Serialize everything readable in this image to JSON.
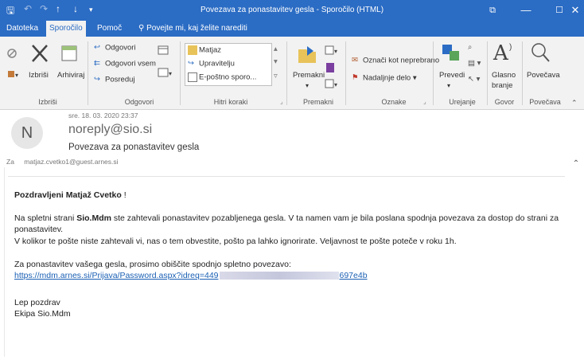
{
  "window": {
    "title": "Povezava za ponastavitev gesla  -  Sporočilo (HTML)",
    "controls": {
      "restore": "⧉",
      "minimize": "—",
      "maximize": "☐",
      "close": "✕"
    }
  },
  "quick_access": {
    "save": "🖫",
    "undo": "↶",
    "redo": "↷",
    "up": "↑",
    "down": "↓",
    "customize": "▾"
  },
  "tabs": [
    "Datoteka",
    "Sporočilo",
    "Pomoč"
  ],
  "tell_me": "Povejte mi, kaj želite narediti",
  "ribbon": {
    "groups": {
      "delete": "Izbriši",
      "respond": "Odgovori",
      "quick_steps": "Hitri koraki",
      "move": "Premakni",
      "tags": "Oznake",
      "editing": "Urejanje",
      "speech": "Govor",
      "zoom": "Povečava"
    },
    "delete_label": "Izbriši",
    "archive_label": "Arhiviraj",
    "reply": "Odgovori",
    "reply_all": "Odgovori vsem",
    "forward": "Posreduj",
    "quick_steps": [
      "Matjaz",
      "Upravitelju",
      "E-poštno sporo..."
    ],
    "move_label": "Premakni",
    "mark_unread": "Označi kot neprebrano",
    "follow_up": "Nadaljnje delo",
    "translate": "Prevedi",
    "read_aloud_1": "Glasno",
    "read_aloud_2": "branje",
    "zoom": "Povečava"
  },
  "message": {
    "avatar_letter": "N",
    "date": "sre. 18. 03. 2020 23:37",
    "sender": "noreply@sio.si",
    "subject": "Povezava za ponastavitev gesla",
    "to_label": "Za",
    "to_address": "matjaz.cvetko1@guest.arnes.si"
  },
  "body": {
    "greeting_bold": "Pozdravljeni Matjaž Cvetko",
    "greeting_end": " !",
    "p1_a": "Na spletni strani ",
    "p1_bold": "Sio.Mdm",
    "p1_b": " ste zahtevali ponastavitev pozabljenega gesla. V ta namen vam je bila poslana spodnja povezava za dostop do strani za",
    "p1_c": "ponastavitev.",
    "p2": "V kolikor te pošte niste zahtevali vi, nas o tem obvestite, pošto pa lahko ignorirate. Veljavnost te pošte poteče v roku 1h.",
    "p3": "Za ponastavitev vašega gesla, prosimo obiščite spodnjo spletno povezavo:",
    "link_start": "https://mdm.arnes.si/Prijava/Password.aspx?idreq=449",
    "link_end": "697e4b",
    "sign1": "Lep pozdrav",
    "sign2": "Ekipa Sio.Mdm"
  }
}
